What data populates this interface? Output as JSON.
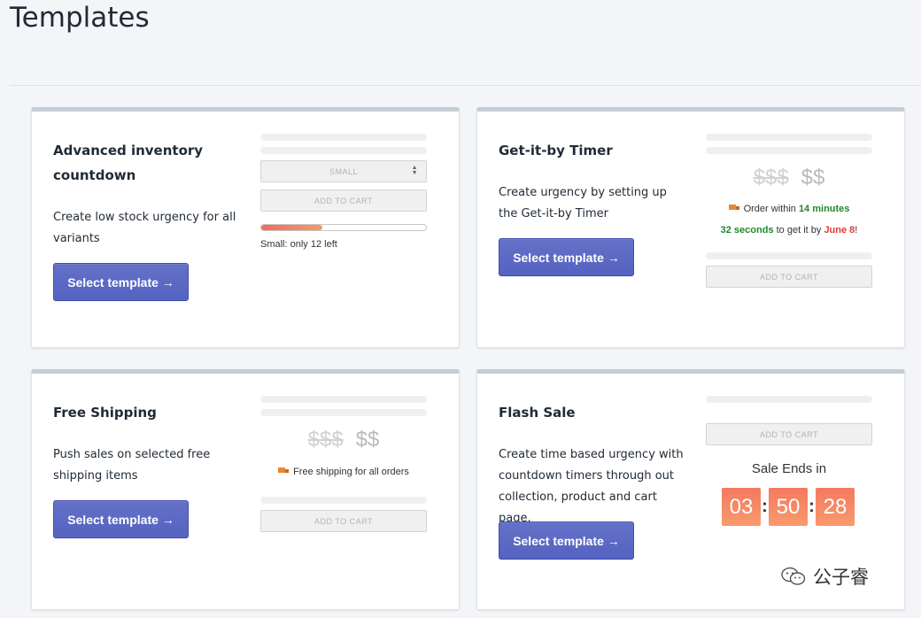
{
  "page": {
    "title": "Templates"
  },
  "cards": [
    {
      "title": "Advanced inventory countdown",
      "description": "Create low stock urgency for all variants",
      "button": "Select template →",
      "preview": {
        "select_value": "SMALL",
        "add_to_cart": "ADD TO CART",
        "progress_percent": 37,
        "stock_note": "Small: only 12 left"
      }
    },
    {
      "title": "Get-it-by Timer",
      "description": "Create urgency by setting up the Get-it-by Timer",
      "button": "Select template →",
      "preview": {
        "old_price": "$$$",
        "new_price": "$$",
        "order_prefix": "Order within ",
        "order_minutes": "14 minutes",
        "seconds": "32 seconds",
        "get_it_by": " to get it by ",
        "date": "June 8",
        "exclaim": "!",
        "add_to_cart": "ADD TO CART"
      }
    },
    {
      "title": "Free Shipping",
      "description": "Push sales on selected free shipping items",
      "button": "Select template →",
      "preview": {
        "old_price": "$$$",
        "new_price": "$$",
        "shipping_text": "Free shipping for all orders",
        "add_to_cart": "ADD TO CART"
      }
    },
    {
      "title": "Flash Sale",
      "description": "Create time based urgency with countdown timers through out collection, product and cart page.",
      "button": "Select template →",
      "preview": {
        "add_to_cart": "ADD TO CART",
        "sale_ends": "Sale Ends in",
        "hours": "03",
        "minutes": "50",
        "seconds": "28",
        "separator": ":"
      }
    }
  ],
  "watermark": {
    "text": "公子睿",
    "icon": "wechat-icon"
  },
  "colors": {
    "primary": "#5c6ac4",
    "timer": "#f6866a",
    "green": "#1f8a2a",
    "red": "#e03a3a"
  }
}
